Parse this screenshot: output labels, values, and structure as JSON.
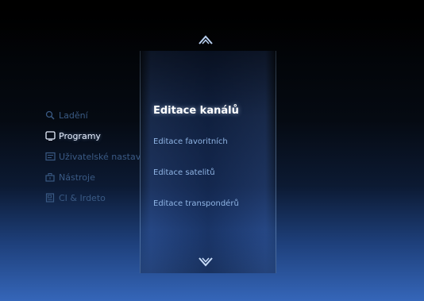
{
  "left_menu": [
    {
      "label": "Ladění",
      "icon": "search-icon",
      "selected": false
    },
    {
      "label": "Programy",
      "icon": "tv-icon",
      "selected": true
    },
    {
      "label": "Uživatelské nastav",
      "icon": "user-settings-icon",
      "selected": false
    },
    {
      "label": "Nástroje",
      "icon": "toolbox-icon",
      "selected": false
    },
    {
      "label": "CI & Irdeto",
      "icon": "card-icon",
      "selected": false
    }
  ],
  "center_menu": [
    {
      "label": "Editace kanálů",
      "selected": true
    },
    {
      "label": "Editace favoritních",
      "selected": false
    },
    {
      "label": "Editace satelitů",
      "selected": false
    },
    {
      "label": "Editace transpondérů",
      "selected": false
    }
  ],
  "icons": {
    "up_arrow": "chevron-up-icon",
    "down_arrow": "chevron-down-icon"
  },
  "colors": {
    "selected_text": "#ffffff",
    "dim_text": "#3a5a84",
    "submenu_text": "#8fb4e4",
    "background_bottom": "#3566b9"
  }
}
